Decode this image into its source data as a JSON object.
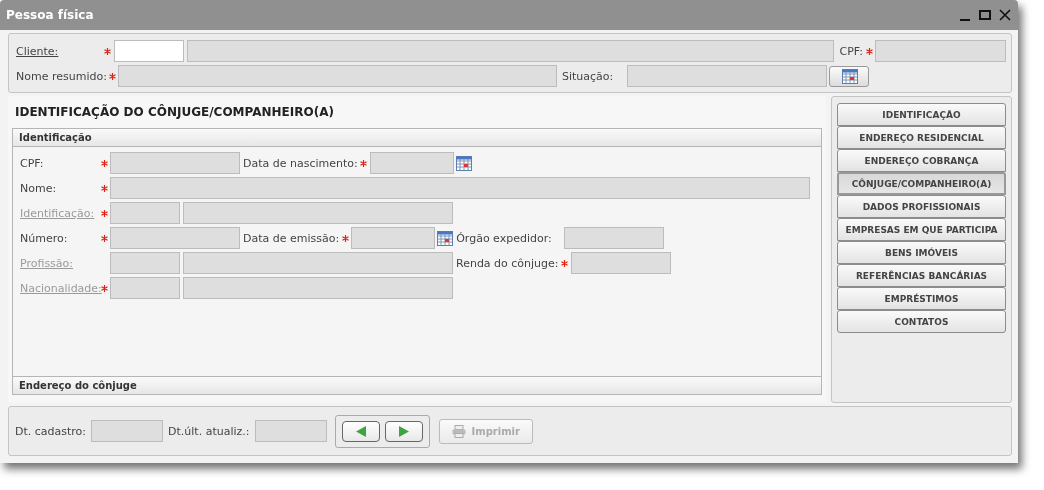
{
  "window": {
    "title": "Pessoa física"
  },
  "header": {
    "cliente": {
      "label": "Cliente:",
      "required": true,
      "link": true
    },
    "cpf": {
      "label": "CPF:",
      "required": true
    },
    "nome_resumido": {
      "label": "Nome resumido:",
      "required": true
    },
    "situacao": {
      "label": "Situação:",
      "required": false
    }
  },
  "section_title": "IDENTIFICAÇÃO DO CÔNJUGE/COMPANHEIRO(A)",
  "panels": [
    {
      "title": "Identificação",
      "expanded": true
    },
    {
      "title": "Endereço do cônjuge",
      "expanded": false
    }
  ],
  "form": [
    [
      {
        "label": "CPF:",
        "required": true,
        "kind": "text",
        "link": false
      },
      {
        "label": "Data de nascimento:",
        "required": true,
        "kind": "date",
        "link": false
      }
    ],
    [
      {
        "label": "Nome:",
        "required": true,
        "kind": "wide",
        "link": false
      }
    ],
    [
      {
        "label": "Identificação:",
        "required": true,
        "kind": "lookup",
        "link": true
      }
    ],
    [
      {
        "label": "Número:",
        "required": true,
        "kind": "text",
        "link": false
      },
      {
        "label": "Data de emissão:",
        "required": true,
        "kind": "date",
        "link": false
      },
      {
        "label": "Órgão expedidor:",
        "required": false,
        "kind": "short",
        "link": false
      }
    ],
    [
      {
        "label": "Profissão:",
        "required": false,
        "kind": "lookup",
        "link": true
      },
      {
        "label": "Renda do cônjuge:",
        "required": true,
        "kind": "short",
        "link": false
      }
    ],
    [
      {
        "label": "Nacionalidade:",
        "required": true,
        "kind": "lookup",
        "link": true
      }
    ]
  ],
  "nav": [
    {
      "label": "IDENTIFICAÇÃO",
      "selected": false
    },
    {
      "label": "ENDEREÇO RESIDENCIAL",
      "selected": false
    },
    {
      "label": "ENDEREÇO COBRANÇA",
      "selected": false
    },
    {
      "label": "CÔNJUGE/COMPANHEIRO(A)",
      "selected": true
    },
    {
      "label": "DADOS PROFISSIONAIS",
      "selected": false
    },
    {
      "label": "EMPRESAS EM QUE PARTICIPA",
      "selected": false
    },
    {
      "label": "BENS IMÓVEIS",
      "selected": false
    },
    {
      "label": "REFERÊNCIAS BANCÁRIAS",
      "selected": false
    },
    {
      "label": "EMPRÉSTIMOS",
      "selected": false
    },
    {
      "label": "CONTATOS",
      "selected": false
    }
  ],
  "footer": {
    "dt_cadastro": "Dt. cadastro:",
    "dt_atualiz": "Dt.últ. atualiz.:",
    "print": {
      "label": "Imprimir",
      "disabled": true
    }
  }
}
